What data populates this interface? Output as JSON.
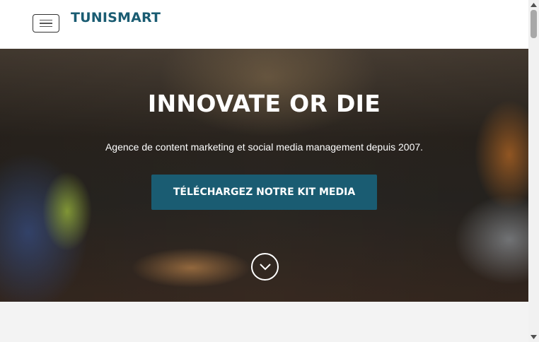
{
  "navbar": {
    "brand": "TUNISMART",
    "toggle_icon": "hamburger-menu-icon"
  },
  "hero": {
    "title": "INNOVATE OR DIE",
    "subtitle": "Agence de content marketing et social media management depuis 2007.",
    "cta_label": "TÉLÉCHARGEZ NOTRE KIT MEDIA",
    "scroll_icon": "chevron-down-icon"
  },
  "colors": {
    "brand": "#1a5c72",
    "hero_text": "#ffffff",
    "page_background": "#f3f3f3"
  }
}
